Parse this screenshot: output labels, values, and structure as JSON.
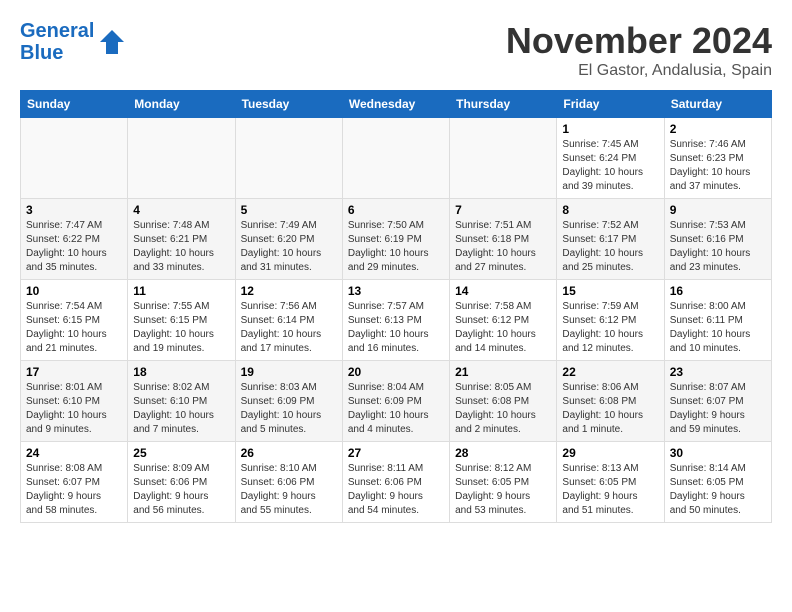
{
  "header": {
    "logo_line1": "General",
    "logo_line2": "Blue",
    "title": "November 2024",
    "subtitle": "El Gastor, Andalusia, Spain"
  },
  "weekdays": [
    "Sunday",
    "Monday",
    "Tuesday",
    "Wednesday",
    "Thursday",
    "Friday",
    "Saturday"
  ],
  "weeks": [
    [
      {
        "day": "",
        "info": ""
      },
      {
        "day": "",
        "info": ""
      },
      {
        "day": "",
        "info": ""
      },
      {
        "day": "",
        "info": ""
      },
      {
        "day": "",
        "info": ""
      },
      {
        "day": "1",
        "info": "Sunrise: 7:45 AM\nSunset: 6:24 PM\nDaylight: 10 hours\nand 39 minutes."
      },
      {
        "day": "2",
        "info": "Sunrise: 7:46 AM\nSunset: 6:23 PM\nDaylight: 10 hours\nand 37 minutes."
      }
    ],
    [
      {
        "day": "3",
        "info": "Sunrise: 7:47 AM\nSunset: 6:22 PM\nDaylight: 10 hours\nand 35 minutes."
      },
      {
        "day": "4",
        "info": "Sunrise: 7:48 AM\nSunset: 6:21 PM\nDaylight: 10 hours\nand 33 minutes."
      },
      {
        "day": "5",
        "info": "Sunrise: 7:49 AM\nSunset: 6:20 PM\nDaylight: 10 hours\nand 31 minutes."
      },
      {
        "day": "6",
        "info": "Sunrise: 7:50 AM\nSunset: 6:19 PM\nDaylight: 10 hours\nand 29 minutes."
      },
      {
        "day": "7",
        "info": "Sunrise: 7:51 AM\nSunset: 6:18 PM\nDaylight: 10 hours\nand 27 minutes."
      },
      {
        "day": "8",
        "info": "Sunrise: 7:52 AM\nSunset: 6:17 PM\nDaylight: 10 hours\nand 25 minutes."
      },
      {
        "day": "9",
        "info": "Sunrise: 7:53 AM\nSunset: 6:16 PM\nDaylight: 10 hours\nand 23 minutes."
      }
    ],
    [
      {
        "day": "10",
        "info": "Sunrise: 7:54 AM\nSunset: 6:15 PM\nDaylight: 10 hours\nand 21 minutes."
      },
      {
        "day": "11",
        "info": "Sunrise: 7:55 AM\nSunset: 6:15 PM\nDaylight: 10 hours\nand 19 minutes."
      },
      {
        "day": "12",
        "info": "Sunrise: 7:56 AM\nSunset: 6:14 PM\nDaylight: 10 hours\nand 17 minutes."
      },
      {
        "day": "13",
        "info": "Sunrise: 7:57 AM\nSunset: 6:13 PM\nDaylight: 10 hours\nand 16 minutes."
      },
      {
        "day": "14",
        "info": "Sunrise: 7:58 AM\nSunset: 6:12 PM\nDaylight: 10 hours\nand 14 minutes."
      },
      {
        "day": "15",
        "info": "Sunrise: 7:59 AM\nSunset: 6:12 PM\nDaylight: 10 hours\nand 12 minutes."
      },
      {
        "day": "16",
        "info": "Sunrise: 8:00 AM\nSunset: 6:11 PM\nDaylight: 10 hours\nand 10 minutes."
      }
    ],
    [
      {
        "day": "17",
        "info": "Sunrise: 8:01 AM\nSunset: 6:10 PM\nDaylight: 10 hours\nand 9 minutes."
      },
      {
        "day": "18",
        "info": "Sunrise: 8:02 AM\nSunset: 6:10 PM\nDaylight: 10 hours\nand 7 minutes."
      },
      {
        "day": "19",
        "info": "Sunrise: 8:03 AM\nSunset: 6:09 PM\nDaylight: 10 hours\nand 5 minutes."
      },
      {
        "day": "20",
        "info": "Sunrise: 8:04 AM\nSunset: 6:09 PM\nDaylight: 10 hours\nand 4 minutes."
      },
      {
        "day": "21",
        "info": "Sunrise: 8:05 AM\nSunset: 6:08 PM\nDaylight: 10 hours\nand 2 minutes."
      },
      {
        "day": "22",
        "info": "Sunrise: 8:06 AM\nSunset: 6:08 PM\nDaylight: 10 hours\nand 1 minute."
      },
      {
        "day": "23",
        "info": "Sunrise: 8:07 AM\nSunset: 6:07 PM\nDaylight: 9 hours\nand 59 minutes."
      }
    ],
    [
      {
        "day": "24",
        "info": "Sunrise: 8:08 AM\nSunset: 6:07 PM\nDaylight: 9 hours\nand 58 minutes."
      },
      {
        "day": "25",
        "info": "Sunrise: 8:09 AM\nSunset: 6:06 PM\nDaylight: 9 hours\nand 56 minutes."
      },
      {
        "day": "26",
        "info": "Sunrise: 8:10 AM\nSunset: 6:06 PM\nDaylight: 9 hours\nand 55 minutes."
      },
      {
        "day": "27",
        "info": "Sunrise: 8:11 AM\nSunset: 6:06 PM\nDaylight: 9 hours\nand 54 minutes."
      },
      {
        "day": "28",
        "info": "Sunrise: 8:12 AM\nSunset: 6:05 PM\nDaylight: 9 hours\nand 53 minutes."
      },
      {
        "day": "29",
        "info": "Sunrise: 8:13 AM\nSunset: 6:05 PM\nDaylight: 9 hours\nand 51 minutes."
      },
      {
        "day": "30",
        "info": "Sunrise: 8:14 AM\nSunset: 6:05 PM\nDaylight: 9 hours\nand 50 minutes."
      }
    ]
  ]
}
